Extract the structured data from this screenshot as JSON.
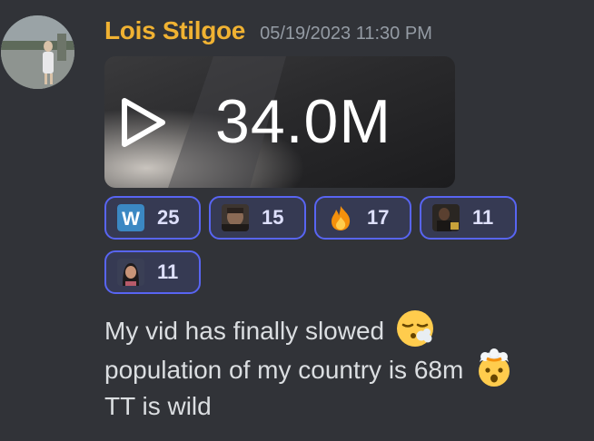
{
  "message": {
    "username": "Lois Stilgoe",
    "timestamp": "05/19/2023 11:30 PM",
    "embed": {
      "views": "34.0M",
      "icon": "play-icon"
    },
    "reactions": [
      {
        "emoji": "w-letter-emoji",
        "count": "25"
      },
      {
        "emoji": "custom-face-emoji",
        "count": "15"
      },
      {
        "emoji": "fire-emoji",
        "count": "17"
      },
      {
        "emoji": "custom-photo-emoji",
        "count": "11"
      },
      {
        "emoji": "custom-portrait-emoji",
        "count": "11"
      }
    ],
    "lines": [
      {
        "text": "My vid has finally slowed",
        "emoji": "face-exhaling-emoji"
      },
      {
        "text": "population of my country is 68m",
        "emoji": "exploding-head-emoji"
      },
      {
        "text": "TT is wild",
        "emoji": ""
      }
    ]
  },
  "colors": {
    "background": "#313338",
    "username": "#f0b232",
    "timestamp": "#949ba4",
    "text": "#dbdee1",
    "reaction_border": "#5865f2",
    "reaction_count": "#dee0fc"
  }
}
